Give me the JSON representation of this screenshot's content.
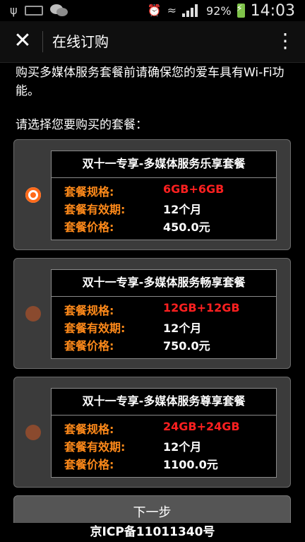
{
  "status_bar": {
    "battery": "92%",
    "time": "14:03",
    "icons": [
      "usb-icon",
      "sim-icon",
      "wechat-icon",
      "alarm-icon",
      "wifi-icon",
      "signal-icon",
      "battery-icon"
    ]
  },
  "header": {
    "close_icon": "✕",
    "title": "在线订购",
    "menu_icon": "⋮"
  },
  "intro": "购买多媒体服务套餐前请确保您的爱车具有Wi-Fi功能。",
  "prompt": "请选择您要购买的套餐：",
  "packages": [
    {
      "title": "双十一专享-多媒体服务乐享套餐",
      "spec_label": "套餐规格:",
      "spec": "6GB+6GB",
      "validity_label": "套餐有效期:",
      "validity": "12个月",
      "price_label": "套餐价格:",
      "price": "450.0元",
      "selected": true
    },
    {
      "title": "双十一专享-多媒体服务畅享套餐",
      "spec_label": "套餐规格:",
      "spec": "12GB+12GB",
      "validity_label": "套餐有效期:",
      "validity": "12个月",
      "price_label": "套餐价格:",
      "price": "750.0元",
      "selected": false
    },
    {
      "title": "双十一专享-多媒体服务尊享套餐",
      "spec_label": "套餐规格:",
      "spec": "24GB+24GB",
      "validity_label": "套餐有效期:",
      "validity": "12个月",
      "price_label": "套餐价格:",
      "price": "1100.0元",
      "selected": false
    }
  ],
  "next_button": "下一步",
  "footer": "京ICP备11011340号",
  "colors": {
    "accent_orange": "#ff6a1a",
    "label_orange": "#ff8a1a",
    "spec_red": "#ff2020",
    "card_bg": "#3b3b3b"
  }
}
